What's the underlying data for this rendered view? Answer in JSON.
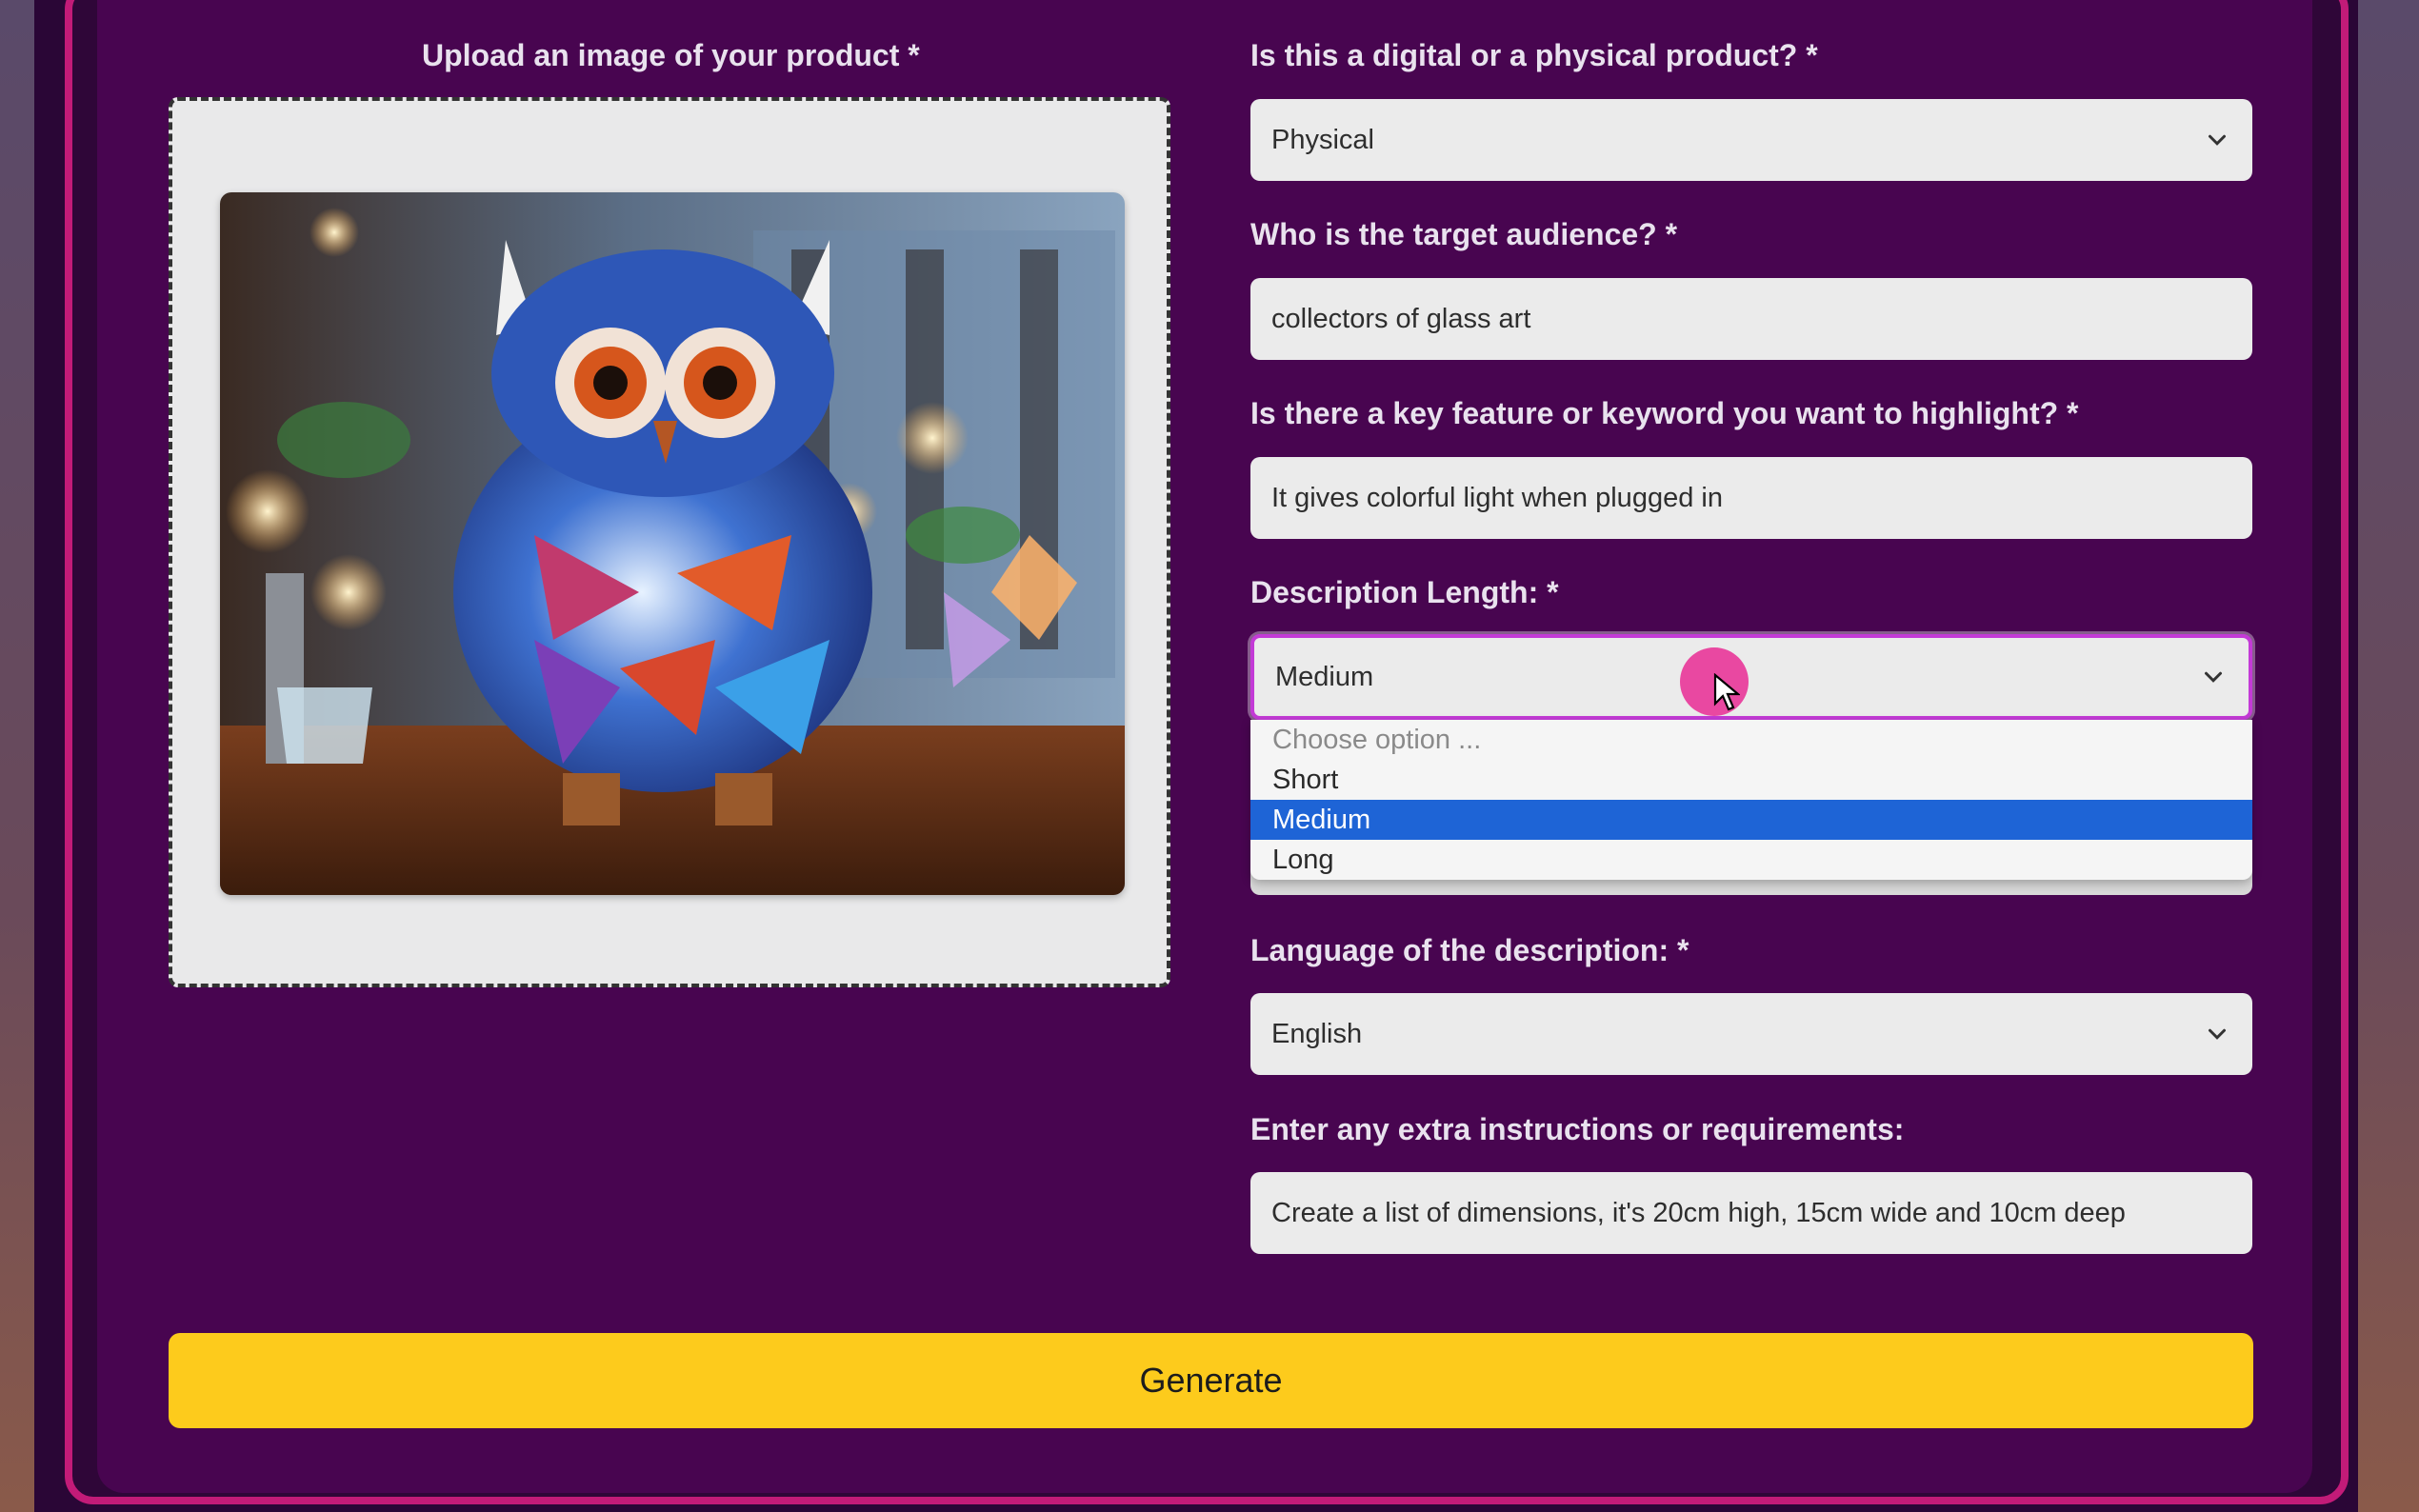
{
  "upload": {
    "label": "Upload an image of your product *",
    "image_alt": "Stained glass owl lamp on a wooden table"
  },
  "product_type": {
    "label": "Is this a digital or a physical product? *",
    "value": "Physical"
  },
  "target_audience": {
    "label": "Who is the target audience? *",
    "value": "collectors of glass art"
  },
  "key_feature": {
    "label": "Is there a key feature or keyword you want to highlight? *",
    "value": "It gives colorful light when plugged in"
  },
  "description_length": {
    "label": "Description Length: *",
    "value": "Medium",
    "options": [
      {
        "label": "Choose option ...",
        "state": "placeholder"
      },
      {
        "label": "Short",
        "state": "normal"
      },
      {
        "label": "Medium",
        "state": "selected"
      },
      {
        "label": "Long",
        "state": "normal"
      }
    ]
  },
  "language": {
    "label": "Language of the description: *",
    "value": "English"
  },
  "extra_instructions": {
    "label": "Enter any extra instructions or requirements:",
    "value": "Create a list of dimensions, it's 20cm high, 15cm wide and 10cm deep"
  },
  "generate_button": {
    "label": "Generate"
  },
  "colors": {
    "panel": "#480550",
    "frame": "#c21b78",
    "button": "#fdcb1c",
    "selected_option": "#1e64d6",
    "focus": "#c33ad6",
    "click_indicator": "#e8399a"
  },
  "icons": [
    "chevron-down-icon",
    "mouse-cursor-icon",
    "click-indicator"
  ]
}
